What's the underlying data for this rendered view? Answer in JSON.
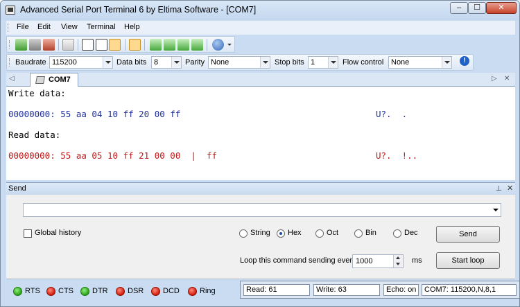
{
  "window": {
    "title": "Advanced Serial Port Terminal 6 by Eltima Software - [COM7]",
    "minimize_glyph": "‒",
    "maximize_glyph": "☐",
    "close_glyph": "✕"
  },
  "menu": {
    "items": [
      "File",
      "Edit",
      "View",
      "Terminal",
      "Help"
    ]
  },
  "toolbar": {
    "icons": [
      "new-connection-icon",
      "open-icon",
      "disconnect-icon",
      "copy-icon",
      "ascii-view-icon",
      "hex-view-icon",
      "dec-view-icon",
      "send-file-icon",
      "save-data-icon",
      "export-icon",
      "import-icon",
      "print-icon",
      "help-icon"
    ]
  },
  "port_settings": {
    "baudrate_label": "Baudrate",
    "baudrate_value": "115200",
    "databits_label": "Data bits",
    "databits_value": "8",
    "parity_label": "Parity",
    "parity_value": "None",
    "stopbits_label": "Stop bits",
    "stopbits_value": "1",
    "flowcontrol_label": "Flow control",
    "flowcontrol_value": "None",
    "info_glyph": "!"
  },
  "tabs": {
    "active_label": "COM7",
    "nav_left": "◁",
    "nav_right": "▷",
    "close": "✕"
  },
  "terminal": {
    "write_header": "Write data:",
    "write_line": "00000000: 55 aa 04 10 ff 20 00 ff",
    "write_ascii": "U?.  .",
    "read_header": "Read data:",
    "read_line": "00000000: 55 aa 05 10 ff 21 00 00  |  ff",
    "read_ascii": "U?.  !..",
    "colors": {
      "write": "#1f2f9e",
      "read": "#c01818"
    }
  },
  "send_panel": {
    "title": "Send",
    "pin_glyph": "⊥",
    "close_glyph": "✕",
    "command_value": "",
    "global_history_label": "Global history",
    "format_options": [
      {
        "label": "String",
        "selected": false
      },
      {
        "label": "Hex",
        "selected": true
      },
      {
        "label": "Oct",
        "selected": false
      },
      {
        "label": "Bin",
        "selected": false
      },
      {
        "label": "Dec",
        "selected": false
      }
    ],
    "send_button": "Send",
    "loop_label": "Loop this command sending every",
    "loop_value": "1000",
    "loop_unit": "ms",
    "start_loop_button": "Start loop"
  },
  "status": {
    "signals": [
      {
        "name": "RTS",
        "state": "green"
      },
      {
        "name": "CTS",
        "state": "red"
      },
      {
        "name": "DTR",
        "state": "green"
      },
      {
        "name": "DSR",
        "state": "red"
      },
      {
        "name": "DCD",
        "state": "red"
      },
      {
        "name": "Ring",
        "state": "red"
      }
    ],
    "read": "Read: 61",
    "write": "Write: 63",
    "echo": "Echo: on",
    "port_info": "COM7: 115200,N,8,1"
  }
}
